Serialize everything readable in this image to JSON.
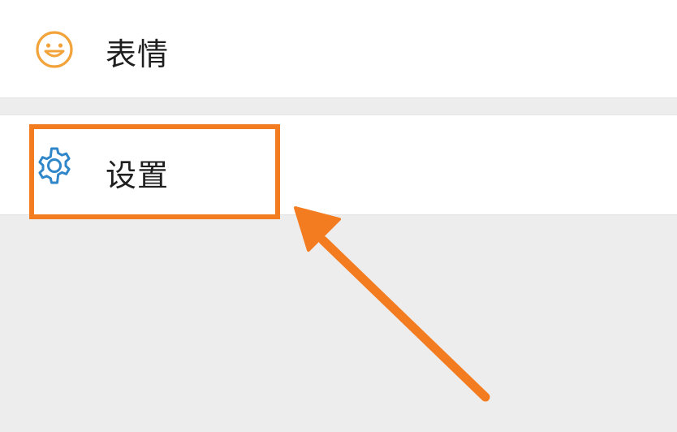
{
  "menu": {
    "emoji": {
      "label": "表情",
      "icon": "smiley-face-icon",
      "icon_color": "#f2a33a"
    },
    "settings": {
      "label": "设置",
      "icon": "gear-icon",
      "icon_color": "#2f86c9"
    }
  },
  "annotation": {
    "highlight_color": "#f47c20",
    "target": "settings"
  }
}
